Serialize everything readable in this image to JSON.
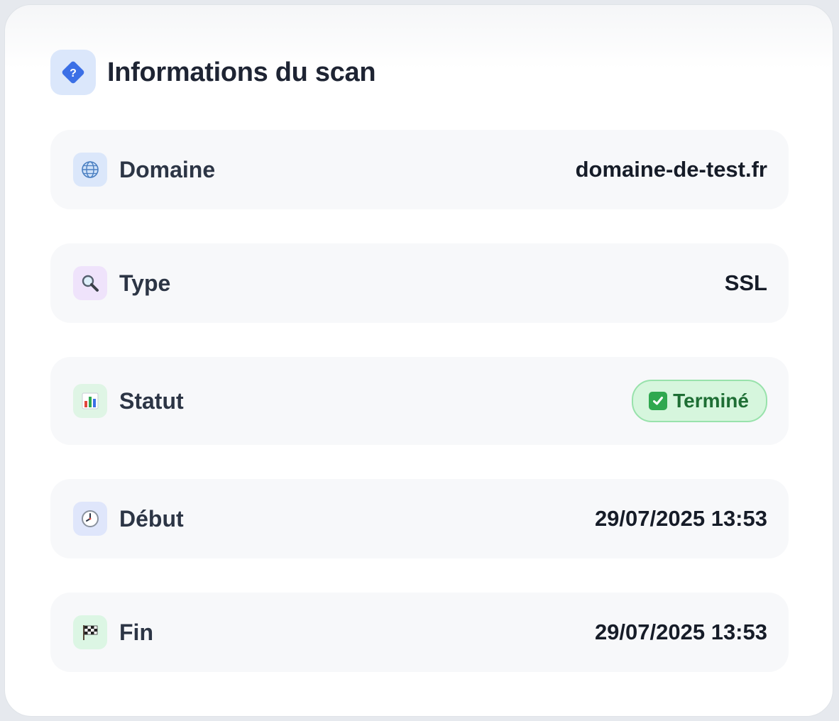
{
  "title": "Informations du scan",
  "icons": {
    "header": "help-diamond-icon",
    "domain": "globe-icon",
    "type": "magnifier-icon",
    "status": "bar-chart-icon",
    "start": "clock-icon",
    "end": "checkered-flag-icon",
    "status_badge": "check-mark-icon"
  },
  "colors": {
    "accent": "#3b6fe6",
    "badge_bg": "#d6f6dd",
    "badge_text": "#1e6e34"
  },
  "rows": [
    {
      "label": "Domaine",
      "value": "domaine-de-test.fr"
    },
    {
      "label": "Type",
      "value": "SSL"
    },
    {
      "label": "Statut",
      "value": "Terminé"
    },
    {
      "label": "Début",
      "value": "29/07/2025 13:53"
    },
    {
      "label": "Fin",
      "value": "29/07/2025 13:53"
    }
  ]
}
